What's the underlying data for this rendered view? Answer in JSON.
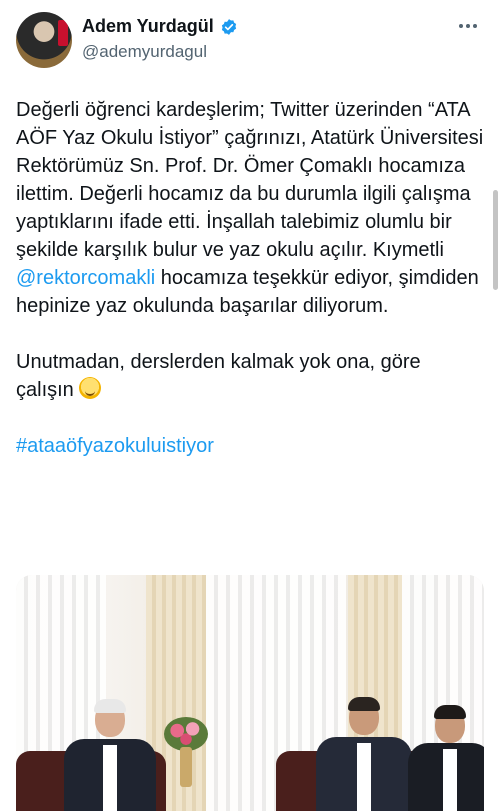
{
  "author": {
    "display_name": "Adem Yurdagül",
    "handle": "@ademyurdagul",
    "verified": true
  },
  "tweet": {
    "paragraph1_before_mention": "Değerli öğrenci kardeşlerim; Twitter üzerinden “ATA AÖF Yaz Okulu İstiyor” çağrınızı, Atatürk Üniversitesi Rektörümüz Sn. Prof. Dr. Ömer Çomaklı hocamıza ilettim. Değerli hocamız da bu durumla ilgili çalışma yaptıklarını ifade etti. İnşallah talebimiz olumlu bir şekilde karşılık bulur ve yaz okulu açılır. Kıymetli ",
    "mention": "@rektorcomakli",
    "paragraph1_after_mention": " hocamıza teşekkür ediyor, şimdiden hepinize yaz okulunda başarılar diliyorum.",
    "paragraph2": "Unutmadan, derslerden kalmak yok ona, göre çalışın",
    "emoji": "smiling-face-icon",
    "hashtag": "#ataaöfyazokuluistiyor"
  },
  "media": {
    "type": "photo"
  },
  "colors": {
    "link": "#1d9bf0",
    "verified": "#1d9bf0",
    "text": "#0f1419",
    "secondary": "#536471"
  }
}
